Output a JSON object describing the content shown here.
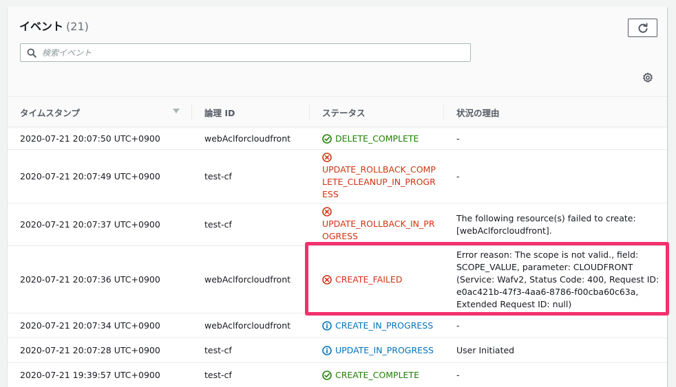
{
  "header": {
    "title": "イベント",
    "count": "(21)",
    "search_placeholder": "検索イベント"
  },
  "columns": {
    "timestamp": "タイムスタンプ",
    "logical_id": "論理 ID",
    "status": "ステータス",
    "reason": "状況の理由"
  },
  "colors": {
    "success": "#1d8102",
    "error": "#d13212",
    "info": "#0073bb",
    "highlight": "#f2306d"
  },
  "rows": [
    {
      "timestamp": "2020-07-21 20:07:50 UTC+0900",
      "logical_id": "webAclforcloudfront",
      "status_lines": [
        "DELETE_COMPLETE"
      ],
      "status_icon": "check-circle-icon",
      "reason_lines": [
        "-"
      ]
    },
    {
      "timestamp": "2020-07-21 20:07:49 UTC+0900",
      "logical_id": "test-cf",
      "status_lines": [
        "UPDATE_ROLLBACK_COMP",
        "LETE_CLEANUP_IN_PROGR",
        "ESS"
      ],
      "status_icon": "error-circle-icon",
      "reason_lines": [
        "-"
      ]
    },
    {
      "timestamp": "2020-07-21 20:07:37 UTC+0900",
      "logical_id": "test-cf",
      "status_lines": [
        "UPDATE_ROLLBACK_IN_PR",
        "OGRESS"
      ],
      "status_icon": "error-circle-icon",
      "reason_lines": [
        "The following resource(s) failed to create:",
        "[webAclforcloudfront]."
      ]
    },
    {
      "timestamp": "2020-07-21 20:07:36 UTC+0900",
      "logical_id": "webAclforcloudfront",
      "status_lines": [
        "CREATE_FAILED"
      ],
      "status_icon": "error-circle-icon",
      "reason_lines": [
        "Error reason: The scope is not valid., field:",
        "SCOPE_VALUE, parameter: CLOUDFRONT",
        "(Service: Wafv2, Status Code: 400, Request ID:",
        "e0ac421b-47f3-4aa6-8786-f00cba60c63a,",
        "Extended Request ID: null)"
      ]
    },
    {
      "timestamp": "2020-07-21 20:07:34 UTC+0900",
      "logical_id": "webAclforcloudfront",
      "status_lines": [
        "CREATE_IN_PROGRESS"
      ],
      "status_icon": "info-circle-icon",
      "reason_lines": [
        "-"
      ]
    },
    {
      "timestamp": "2020-07-21 20:07:28 UTC+0900",
      "logical_id": "test-cf",
      "status_lines": [
        "UPDATE_IN_PROGRESS"
      ],
      "status_icon": "info-circle-icon",
      "reason_lines": [
        "User Initiated"
      ]
    },
    {
      "timestamp": "2020-07-21 19:39:57 UTC+0900",
      "logical_id": "test-cf",
      "status_lines": [
        "CREATE_COMPLETE"
      ],
      "status_icon": "check-circle-icon",
      "reason_lines": [
        "-"
      ]
    }
  ]
}
